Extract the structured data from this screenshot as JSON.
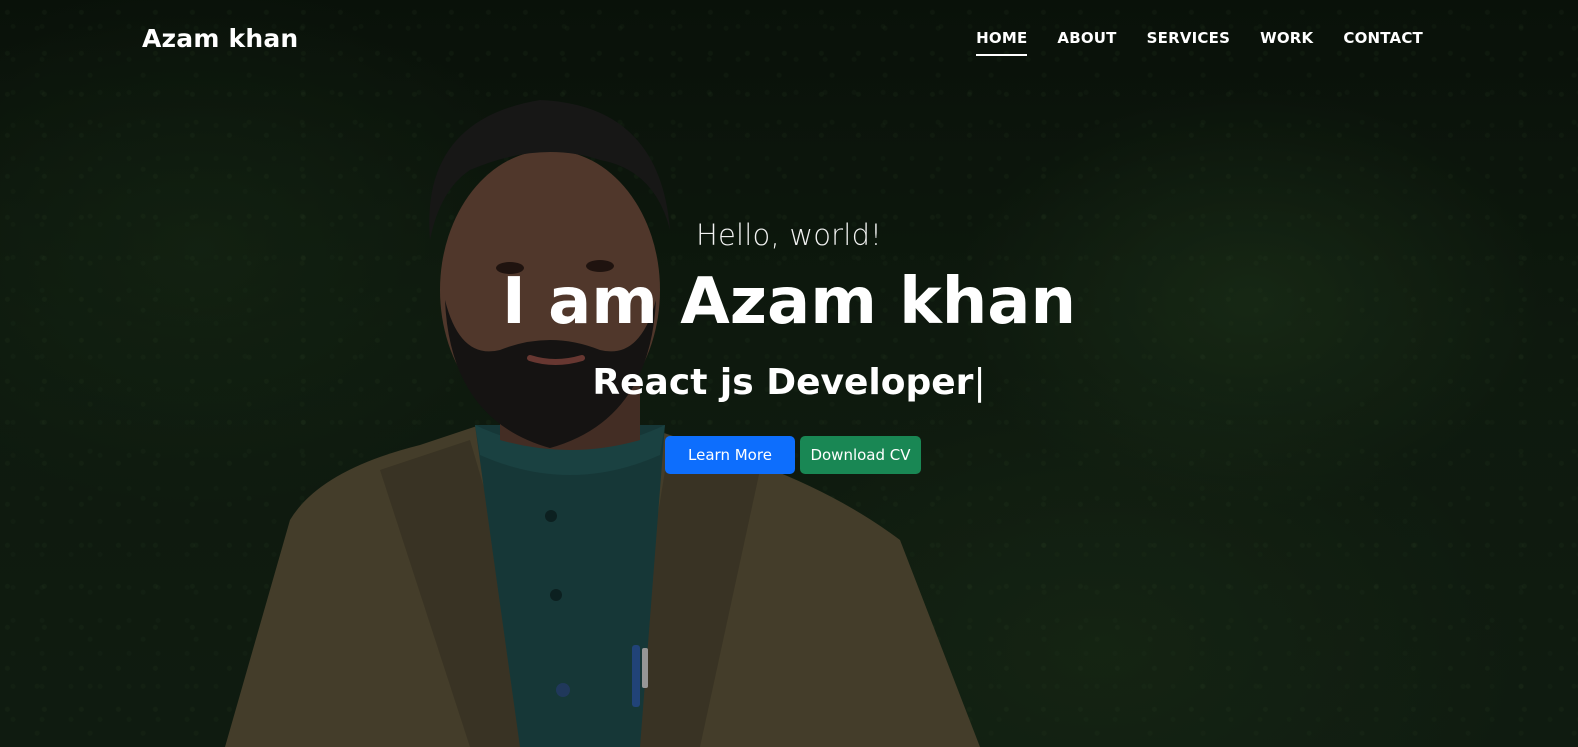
{
  "colors": {
    "primary_button": "#0d6efd",
    "success_button": "#198754",
    "text": "#ffffff",
    "background": "#132213"
  },
  "navbar": {
    "brand": "Azam khan",
    "links": [
      {
        "label": "HOME",
        "active": true
      },
      {
        "label": "ABOUT",
        "active": false
      },
      {
        "label": "SERVICES",
        "active": false
      },
      {
        "label": "WORK",
        "active": false
      },
      {
        "label": "CONTACT",
        "active": false
      }
    ]
  },
  "hero": {
    "greeting": "Hello, world!",
    "headline": "I am Azam khan",
    "role": "React js Developer",
    "cursor": "|",
    "learn_more_label": "Learn More",
    "download_cv_label": "Download CV",
    "background_image": "portrait-photo"
  }
}
